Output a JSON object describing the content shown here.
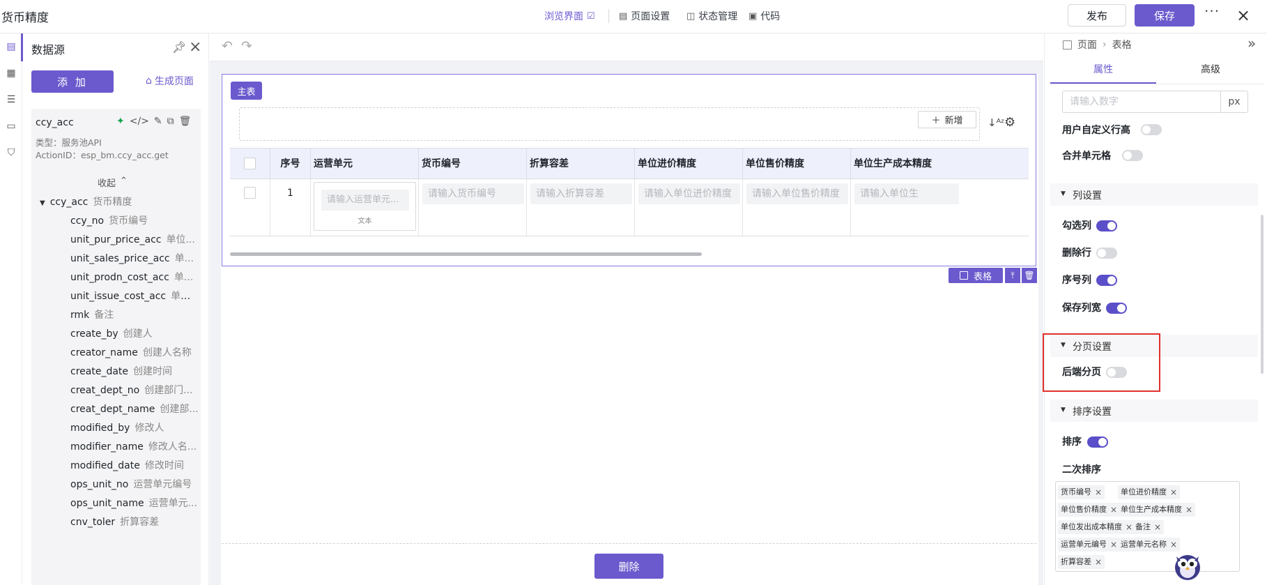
{
  "app": {
    "title": "货币精度"
  },
  "topbar": {
    "browse": "浏览界面",
    "page_settings": "页面设置",
    "state_mgmt": "状态管理",
    "code": "代码",
    "publish": "发布",
    "save": "保存",
    "more": "···",
    "close": "×"
  },
  "datasource": {
    "title": "数据源",
    "add": "添 加",
    "generate": "生成页面",
    "name": "ccy_acc",
    "type_line": "类型：服务池API",
    "action_line": "ActionID：esp_bm.ccy_acc.get",
    "collapse": "收起",
    "root": {
      "field": "ccy_acc",
      "label": "货币精度"
    },
    "fields": [
      {
        "field": "ccy_no",
        "label": "货币编号"
      },
      {
        "field": "unit_pur_price_acc",
        "label": "单位..."
      },
      {
        "field": "unit_sales_price_acc",
        "label": "单..."
      },
      {
        "field": "unit_prodn_cost_acc",
        "label": "单..."
      },
      {
        "field": "unit_issue_cost_acc",
        "label": "单位..."
      },
      {
        "field": "rmk",
        "label": "备注"
      },
      {
        "field": "create_by",
        "label": "创建人"
      },
      {
        "field": "creator_name",
        "label": "创建人名称"
      },
      {
        "field": "create_date",
        "label": "创建时间"
      },
      {
        "field": "creat_dept_no",
        "label": "创建部门..."
      },
      {
        "field": "creat_dept_name",
        "label": "创建部..."
      },
      {
        "field": "modified_by",
        "label": "修改人"
      },
      {
        "field": "modifier_name",
        "label": "修改人名..."
      },
      {
        "field": "modified_date",
        "label": "修改时间"
      },
      {
        "field": "ops_unit_no",
        "label": "运营单元编号"
      },
      {
        "field": "ops_unit_name",
        "label": "运营单元..."
      },
      {
        "field": "cnv_toler",
        "label": "折算容差"
      }
    ]
  },
  "canvas": {
    "main_tag": "主表",
    "new_button": "新增",
    "table_tag": "表格",
    "delete_button": "删除",
    "columns": [
      "序号",
      "运营单元",
      "货币编号",
      "折算容差",
      "单位进价精度",
      "单位售价精度",
      "单位生产成本精度"
    ],
    "row": {
      "index": "1",
      "ops_placeholder": "请输入运营单元...",
      "ops_caption": "文本",
      "placeholders": [
        "请输入货币编号",
        "请输入折算容差",
        "请输入单位进价精度",
        "请输入单位售价精度",
        "请输入单位生"
      ]
    }
  },
  "props": {
    "breadcrumb": [
      "页面",
      "表格"
    ],
    "tab_attr": "属性",
    "tab_adv": "高级",
    "num_placeholder": "请输入数字",
    "num_unit": "px",
    "custom_row_height": {
      "label": "用户自定义行高",
      "on": false
    },
    "merge_cells": {
      "label": "合并单元格",
      "on": false
    },
    "col_section": "列设置",
    "check_col": {
      "label": "勾选列",
      "on": true
    },
    "delete_row": {
      "label": "删除行",
      "on": false
    },
    "index_col": {
      "label": "序号列",
      "on": true
    },
    "save_width": {
      "label": "保存列宽",
      "on": true
    },
    "page_section": "分页设置",
    "backend_paging": {
      "label": "后端分页",
      "on": false
    },
    "sort_section": "排序设置",
    "sort": {
      "label": "排序",
      "on": true
    },
    "secondary_sort": "二次排序",
    "sort_chips": [
      "货币编号",
      "单位进价精度",
      "单位售价精度",
      "单位生产成本精度",
      "单位发出成本精度",
      "备注",
      "运营单元编号",
      "运营单元名称",
      "折算容差"
    ]
  },
  "colors": {
    "accent": "#6a5acd",
    "highlight": "#e0302d"
  }
}
